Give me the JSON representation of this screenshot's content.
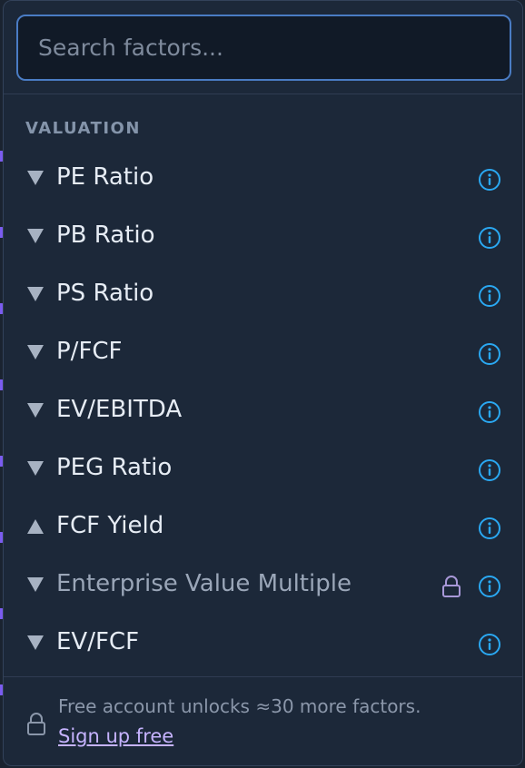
{
  "search": {
    "placeholder": "Search factors..."
  },
  "section": {
    "title": "VALUATION"
  },
  "factors": [
    {
      "label": "PE Ratio",
      "direction": "down",
      "locked": false
    },
    {
      "label": "PB Ratio",
      "direction": "down",
      "locked": false
    },
    {
      "label": "PS Ratio",
      "direction": "down",
      "locked": false
    },
    {
      "label": "P/FCF",
      "direction": "down",
      "locked": false
    },
    {
      "label": "EV/EBITDA",
      "direction": "down",
      "locked": false
    },
    {
      "label": "PEG Ratio",
      "direction": "down",
      "locked": false
    },
    {
      "label": "FCF Yield",
      "direction": "up",
      "locked": false
    },
    {
      "label": "Enterprise Value Multiple",
      "direction": "down",
      "locked": true
    },
    {
      "label": "EV/FCF",
      "direction": "down",
      "locked": false
    }
  ],
  "footer": {
    "message": "Free account unlocks ≈30 more factors.",
    "link_label": "Sign up free"
  },
  "icons": {
    "info": "info-circle-icon",
    "lock": "lock-icon",
    "sort_down": "triangle-down-icon",
    "sort_up": "triangle-up-icon"
  },
  "colors": {
    "panel_bg": "#1c2839",
    "accent_blue": "#2aa8f2",
    "link_purple": "#c6b3ff",
    "lock_purple": "#a898d8",
    "search_border": "#4a7cc4",
    "edge_marker": "#7b5cf0"
  }
}
